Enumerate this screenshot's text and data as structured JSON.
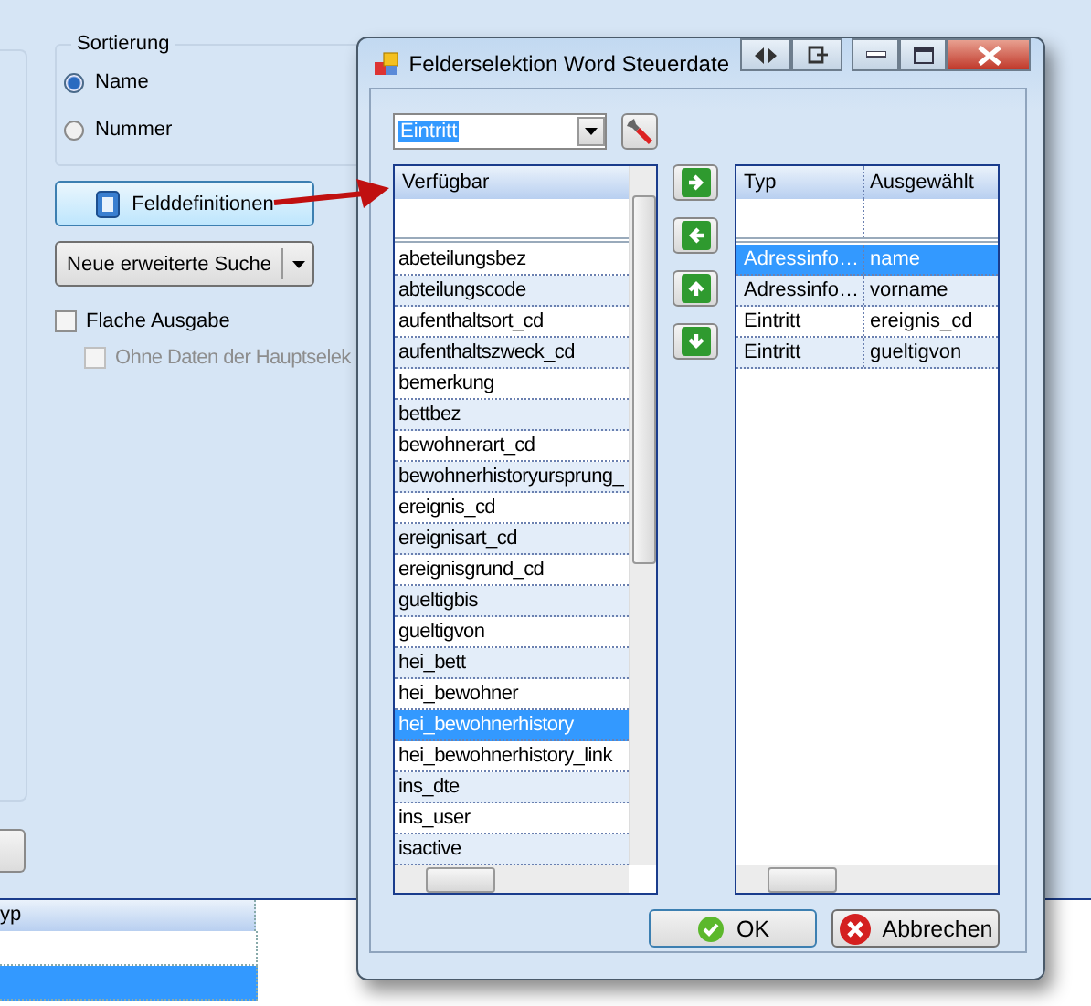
{
  "background": {
    "sort_group": {
      "title": "Sortierung",
      "options": [
        {
          "label": "Name",
          "selected": true
        },
        {
          "label": "Nummer",
          "selected": false
        }
      ]
    },
    "field_definitions_button": "Felddefinitionen",
    "search_button": "Neue erweiterte Suche",
    "checkboxes": [
      {
        "label": "Flache Ausgabe",
        "checked": false,
        "disabled": false
      },
      {
        "label": "Ohne Daten der Hauptselek",
        "checked": false,
        "disabled": true
      }
    ],
    "grid": {
      "header": "yp",
      "rows": [
        {
          "selected": false
        },
        {
          "selected": true
        }
      ]
    }
  },
  "dialog": {
    "title": "Felderselektion Word Steuerdate",
    "combo": "Eintritt",
    "available": {
      "header": "Verfügbar",
      "items": [
        {
          "label": "abeteilungsbez",
          "selected": false
        },
        {
          "label": "abteilungscode",
          "selected": false
        },
        {
          "label": "aufenthaltsort_cd",
          "selected": false
        },
        {
          "label": "aufenthaltszweck_cd",
          "selected": false
        },
        {
          "label": "bemerkung",
          "selected": false
        },
        {
          "label": "bettbez",
          "selected": false
        },
        {
          "label": "bewohnerart_cd",
          "selected": false
        },
        {
          "label": "bewohnerhistoryursprung_",
          "selected": false
        },
        {
          "label": "ereignis_cd",
          "selected": false
        },
        {
          "label": "ereignisart_cd",
          "selected": false
        },
        {
          "label": "ereignisgrund_cd",
          "selected": false
        },
        {
          "label": "gueltigbis",
          "selected": false
        },
        {
          "label": "gueltigvon",
          "selected": false
        },
        {
          "label": "hei_bett",
          "selected": false
        },
        {
          "label": "hei_bewohner",
          "selected": false
        },
        {
          "label": "hei_bewohnerhistory",
          "selected": true
        },
        {
          "label": "hei_bewohnerhistory_link",
          "selected": false
        },
        {
          "label": "ins_dte",
          "selected": false
        },
        {
          "label": "ins_user",
          "selected": false
        },
        {
          "label": "isactive",
          "selected": false
        }
      ]
    },
    "chosen": {
      "columns": [
        "Typ",
        "Ausgewählt"
      ],
      "rows": [
        {
          "type": "Adressinfo…",
          "field": "name",
          "selected": true
        },
        {
          "type": "Adressinfo…",
          "field": "vorname",
          "selected": false
        },
        {
          "type": "Eintritt",
          "field": "ereignis_cd",
          "selected": false
        },
        {
          "type": "Eintritt",
          "field": "gueltigvon",
          "selected": false
        }
      ]
    },
    "buttons": [
      {
        "label": "OK",
        "kind": "ok"
      },
      {
        "label": "Abbrechen",
        "kind": "cancel"
      }
    ]
  }
}
